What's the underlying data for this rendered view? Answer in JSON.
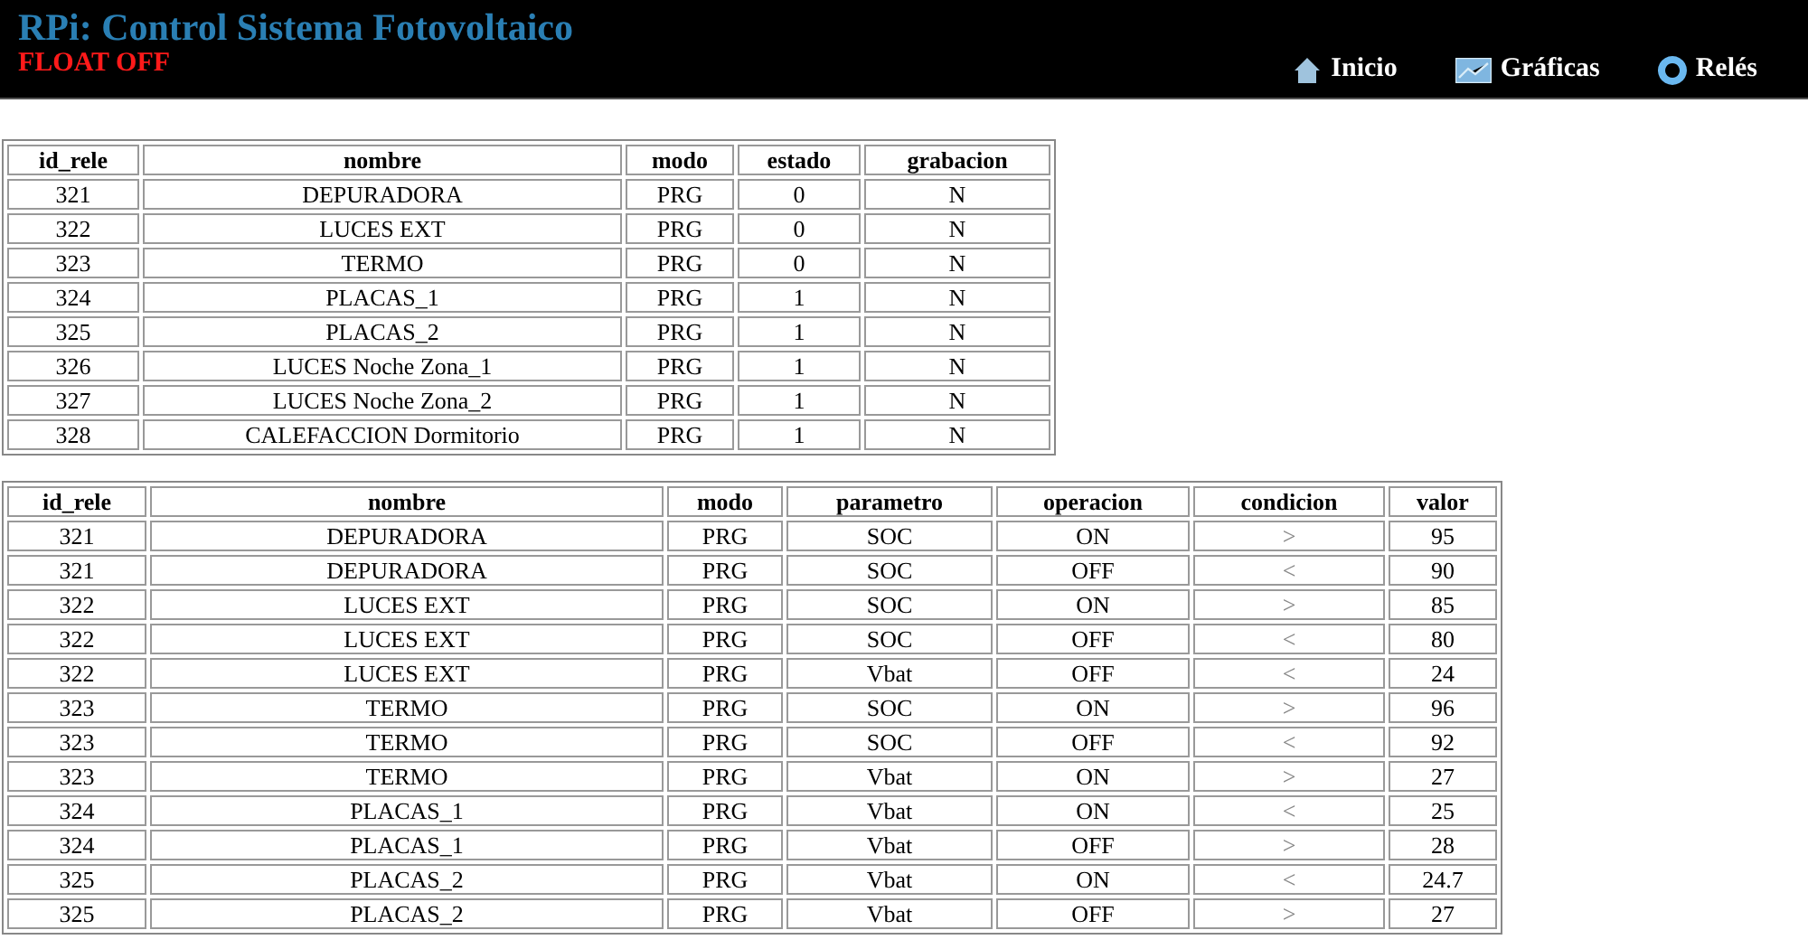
{
  "header": {
    "title": "RPi: Control Sistema Fotovoltaico",
    "status": "FLOAT OFF"
  },
  "nav": [
    {
      "label": "Inicio"
    },
    {
      "label": "Gráficas"
    },
    {
      "label": "Relés"
    }
  ],
  "tables": [
    {
      "columns": [
        "id_rele",
        "nombre",
        "modo",
        "estado",
        "grabacion"
      ],
      "rows": [
        [
          "321",
          "DEPURADORA",
          "PRG",
          "0",
          "N"
        ],
        [
          "322",
          "LUCES EXT",
          "PRG",
          "0",
          "N"
        ],
        [
          "323",
          "TERMO",
          "PRG",
          "0",
          "N"
        ],
        [
          "324",
          "PLACAS_1",
          "PRG",
          "1",
          "N"
        ],
        [
          "325",
          "PLACAS_2",
          "PRG",
          "1",
          "N"
        ],
        [
          "326",
          "LUCES Noche Zona_1",
          "PRG",
          "1",
          "N"
        ],
        [
          "327",
          "LUCES Noche Zona_2",
          "PRG",
          "1",
          "N"
        ],
        [
          "328",
          "CALEFACCION Dormitorio",
          "PRG",
          "1",
          "N"
        ]
      ]
    },
    {
      "columns": [
        "id_rele",
        "nombre",
        "modo",
        "parametro",
        "operacion",
        "condicion",
        "valor"
      ],
      "rows": [
        [
          "321",
          "DEPURADORA",
          "PRG",
          "SOC",
          "ON",
          ">",
          "95"
        ],
        [
          "321",
          "DEPURADORA",
          "PRG",
          "SOC",
          "OFF",
          "<",
          "90"
        ],
        [
          "322",
          "LUCES EXT",
          "PRG",
          "SOC",
          "ON",
          ">",
          "85"
        ],
        [
          "322",
          "LUCES EXT",
          "PRG",
          "SOC",
          "OFF",
          "<",
          "80"
        ],
        [
          "322",
          "LUCES EXT",
          "PRG",
          "Vbat",
          "OFF",
          "<",
          "24"
        ],
        [
          "323",
          "TERMO",
          "PRG",
          "SOC",
          "ON",
          ">",
          "96"
        ],
        [
          "323",
          "TERMO",
          "PRG",
          "SOC",
          "OFF",
          "<",
          "92"
        ],
        [
          "323",
          "TERMO",
          "PRG",
          "Vbat",
          "ON",
          ">",
          "27"
        ],
        [
          "324",
          "PLACAS_1",
          "PRG",
          "Vbat",
          "ON",
          "<",
          "25"
        ],
        [
          "324",
          "PLACAS_1",
          "PRG",
          "Vbat",
          "OFF",
          ">",
          "28"
        ],
        [
          "325",
          "PLACAS_2",
          "PRG",
          "Vbat",
          "ON",
          "<",
          "24.7"
        ],
        [
          "325",
          "PLACAS_2",
          "PRG",
          "Vbat",
          "OFF",
          ">",
          "27"
        ]
      ]
    }
  ]
}
